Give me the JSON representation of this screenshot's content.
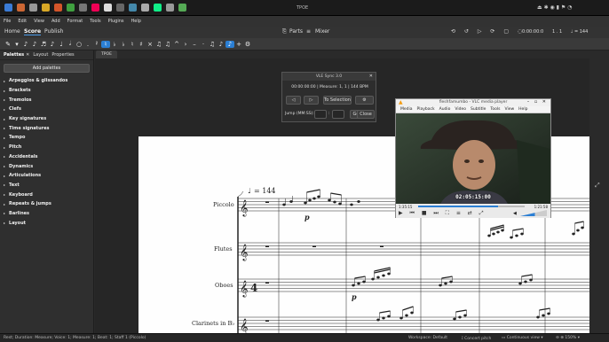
{
  "taskbar": {
    "window_title": "TPOE"
  },
  "menubar": [
    "File",
    "Edit",
    "View",
    "Add",
    "Format",
    "Tools",
    "Plugins",
    "Help"
  ],
  "toolbar": {
    "home": "Home",
    "score": "Score",
    "publish": "Publish",
    "parts": "Parts",
    "mixer": "Mixer",
    "time": "0:00:00:0",
    "position": "1 . 1",
    "tempo": "♩ = 144"
  },
  "panel": {
    "tabs": [
      "Palettes",
      "Layout",
      "Properties"
    ],
    "add_palettes": "Add palettes",
    "items": [
      "Arpeggios & glissandos",
      "Brackets",
      "Tremolos",
      "Clefs",
      "Key signatures",
      "Time signatures",
      "Tempo",
      "Pitch",
      "Accidentals",
      "Dynamics",
      "Articulations",
      "Text",
      "Keyboard",
      "Repeats & jumps",
      "Barlines",
      "Layout"
    ]
  },
  "doc_tab": "TPOE",
  "vle": {
    "title": "VLE Sync 3.0",
    "readout": "00:00:00:00 | Measure: 1, 1 | 144 BPM",
    "to_selection": "To Selection",
    "jump_label": "Jump (MM:SS):",
    "jump_sep": ":",
    "go": "Go",
    "close": "Close"
  },
  "vlc": {
    "title": "fleshfamumbo - VLC media player",
    "menu": [
      "Media",
      "Playback",
      "Audio",
      "Video",
      "Subtitle",
      "Tools",
      "View",
      "Help"
    ],
    "overlay_time": "02:05:15:00",
    "elapsed": "1:35:15",
    "total": "1:21:58",
    "seek_fraction": 0.75,
    "volume_fraction": 0.55
  },
  "score": {
    "tempo_mark": "= 144",
    "instruments": [
      "Piccolo",
      "Flutes",
      "Oboes",
      "Clarinets in B♭"
    ],
    "time_sig": "4",
    "dynamic": "p"
  },
  "status": {
    "left": "Rest; Duration: Measure; Voice: 1; Measure: 1; Beat: 1; Staff 1 (Piccolo)",
    "workspace": "Workspace: Default",
    "concert_pitch": "Concert pitch",
    "view_mode": "Continuous view",
    "zoom": "150%"
  }
}
